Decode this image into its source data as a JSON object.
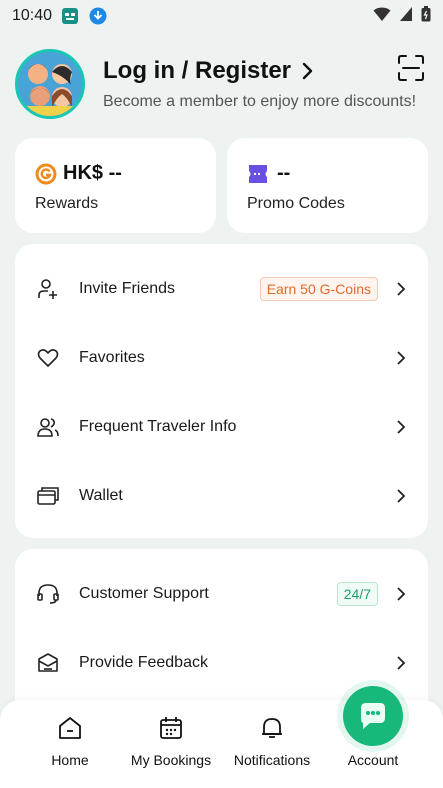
{
  "status_bar": {
    "time": "10:40"
  },
  "profile": {
    "title": "Log in / Register",
    "subtitle": "Become a member to enjoy more discounts!"
  },
  "rewards": {
    "value": "HK$ --",
    "label": "Rewards"
  },
  "promo": {
    "value": "--",
    "label": "Promo Codes"
  },
  "menu_group_1": [
    {
      "label": "Invite Friends",
      "icon": "add-user-icon",
      "badge": "Earn 50 G-Coins"
    },
    {
      "label": "Favorites",
      "icon": "heart-icon"
    },
    {
      "label": "Frequent Traveler Info",
      "icon": "users-icon"
    },
    {
      "label": "Wallet",
      "icon": "wallet-icon"
    }
  ],
  "menu_group_2": [
    {
      "label": "Customer Support",
      "icon": "headset-icon",
      "badge": "24/7"
    },
    {
      "label": "Provide Feedback",
      "icon": "feedback-icon"
    }
  ],
  "tabbar": [
    {
      "label": "Home",
      "icon": "home-icon"
    },
    {
      "label": "My Bookings",
      "icon": "calendar-icon"
    },
    {
      "label": "Notifications",
      "icon": "bell-icon"
    },
    {
      "label": "Account",
      "icon": "account-icon"
    }
  ],
  "colors": {
    "background": "#eef3f2",
    "accent_teal": "#18c7b4",
    "badge_orange": "#e06b2e",
    "badge_green": "#1e9e67",
    "fab_green": "#17b87a",
    "promo_purple": "#6b4fe0",
    "coin_orange": "#f08a1c"
  }
}
